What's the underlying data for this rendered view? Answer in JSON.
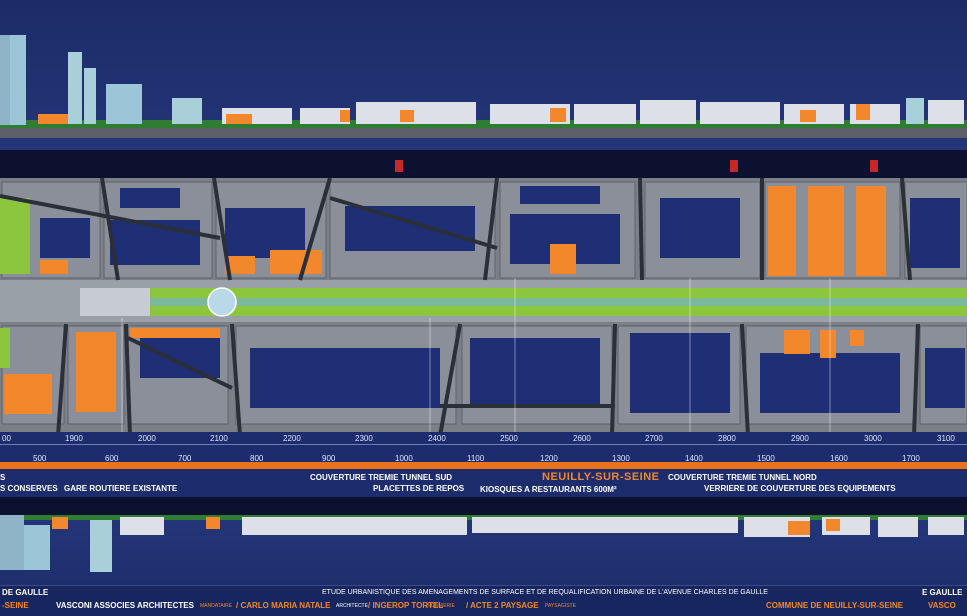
{
  "scale": {
    "top_ticks": [
      "00",
      "1900",
      "2000",
      "2100",
      "2200",
      "2300",
      "2400",
      "2500",
      "2600",
      "2700",
      "2800",
      "2900",
      "3000",
      "3100"
    ],
    "bottom_ticks": [
      "500",
      "600",
      "700",
      "800",
      "900",
      "1000",
      "1100",
      "1200",
      "1300",
      "1400",
      "1500",
      "1600",
      "1700"
    ]
  },
  "city_label": "NEUILLY-SUR-SEINE",
  "legend": {
    "item1": "S",
    "item2": "S CONSERVES",
    "item3": "GARE ROUTIERE EXISTANTE",
    "item4": "COUVERTURE TREMIE TUNNEL SUD",
    "item5": "PLACETTES DE REPOS",
    "item6": "KIOSQUES A RESTAURANTS 600M²",
    "item7": "COUVERTURE TREMIE TUNNEL NORD",
    "item8": "VERRIERE DE COUVERTURE DES EQUIPEMENTS"
  },
  "footer": {
    "left_top": "DE GAULLE",
    "left_bottom": "-SEINE",
    "study_title": "ETUDE URBANISTIQUE DES AMENAGEMENTS DE SURFACE ET DE REQUALIFICATION URBAINE DE L'AVENUE CHARLES DE GAULLE",
    "right_top": "E GAULLE",
    "architect": "VASCONI ASSOCIES ARCHITECTES",
    "mandataire": "MANDATAIRE",
    "partner": "/ CARLO MARIA NATALE",
    "partner_role": "ARCHITECTE",
    "bet": "/ INGEROP TORTEL",
    "bet_role": "INGENIERIE",
    "landscape": "/ ACTE 2 PAYSAGE",
    "landscape_role": "PAYSAGISTE",
    "commune": "COMMUNE DE NEUILLY-SUR-SEINE",
    "right_bottom": "VASCO"
  },
  "colors": {
    "navy": "#1e2f6e",
    "orange": "#e8731b",
    "green": "#8cc63f",
    "grey": "#8a8f99"
  }
}
